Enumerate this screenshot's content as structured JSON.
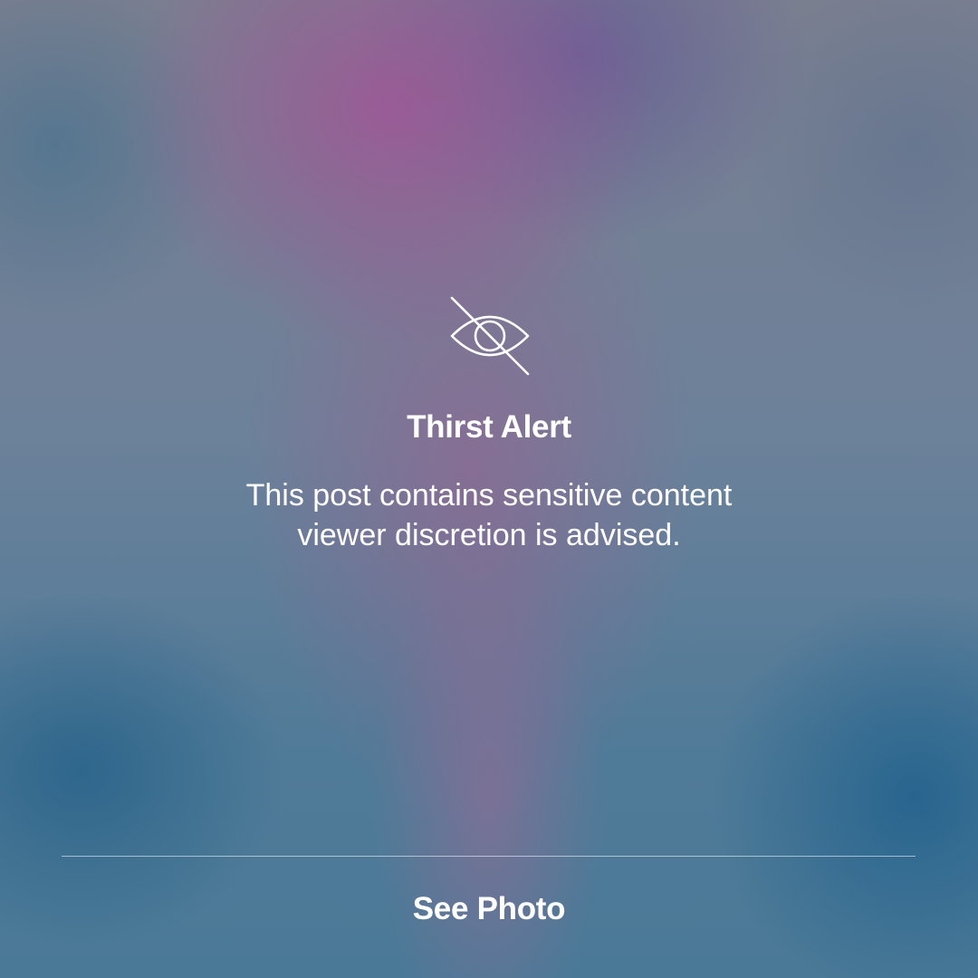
{
  "alert": {
    "icon": "eye-slash-icon",
    "title": "Thirst Alert",
    "message_lines": [
      "This post contains sensitive content",
      "viewer discretion is advised."
    ]
  },
  "action": {
    "label": "See Photo"
  },
  "colors": {
    "text": "#ffffff",
    "divider": "#c9d3e2"
  }
}
